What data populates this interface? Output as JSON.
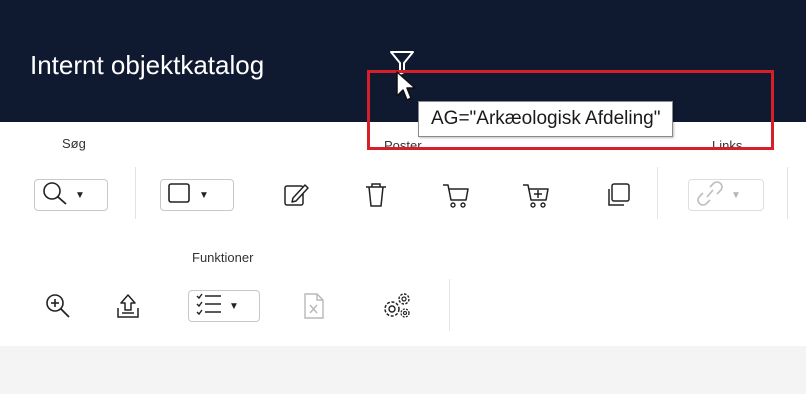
{
  "header": {
    "title": "Internt objektkatalog",
    "filter_icon": "filter-icon",
    "background_color": "#0f1930"
  },
  "tooltip": {
    "text": "AG=\"Arkæologisk Afdeling\"",
    "highlight_color": "#d61f28"
  },
  "toolbar": {
    "groups": {
      "search": {
        "label": "Søg",
        "icons": [
          "search-icon"
        ]
      },
      "records": {
        "label": "Poster",
        "icons": [
          "checkbox-select-icon",
          "edit-icon",
          "delete-icon",
          "cart-icon",
          "cart-add-icon",
          "copy-icon"
        ]
      },
      "links": {
        "label": "Links",
        "icons": [
          "link-icon"
        ]
      },
      "functions": {
        "label": "Funktioner",
        "icons": [
          "zoom-in-icon",
          "export-icon",
          "checklist-icon",
          "excel-icon",
          "settings-icon"
        ]
      }
    }
  }
}
